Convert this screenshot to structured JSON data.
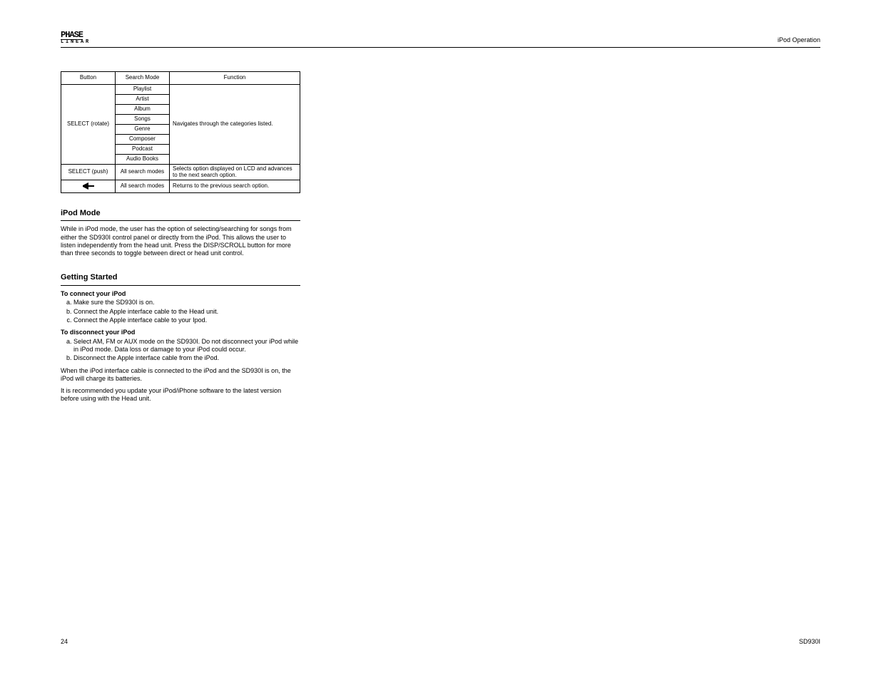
{
  "logo": {
    "main": "PHASE",
    "sub": "LINEAR"
  },
  "headerRight": "iPod Operation",
  "table": {
    "headers": {
      "button": "Button",
      "mode": "Search Mode",
      "function": "Function"
    },
    "row_select": {
      "button": "SELECT (rotate)",
      "modes": [
        "Playlist",
        "Artist",
        "Album",
        "Songs",
        "Genre",
        "Composer",
        "Podcast",
        "Audio Books"
      ],
      "function": "Navigates through the categories listed."
    },
    "row_select_push": {
      "button": "SELECT (push)",
      "mode": "All search modes",
      "function": "Selects option displayed on LCD and advances to the next search option."
    },
    "row_seek": {
      "button_icon": "seek-icon",
      "mode": "All search modes",
      "function": "Returns to the previous search option."
    }
  },
  "ipodMode": {
    "title": "iPod Mode",
    "body": "While in iPod mode, the user has the option of selecting/searching for songs from either the SD930I control panel or directly from the iPod. This allows the user to listen independently from the head unit. Press the DISP/SCROLL button for more than three seconds to toggle between direct or head unit control."
  },
  "getStarted": {
    "title": "Getting Started",
    "connect": {
      "head": "To connect your iPod",
      "steps": [
        "Make sure the SD930I is on.",
        "Connect the Apple interface cable to the Head unit.",
        "Connect the Apple interface cable to your Ipod."
      ]
    },
    "disconnect": {
      "head": "To disconnect your iPod",
      "steps": [
        "Select AM, FM or AUX mode on the SD930I. Do not disconnect your iPod while in iPod mode. Data loss or damage to your iPod could occur.",
        "Disconnect the Apple interface cable from the iPod."
      ]
    },
    "chargingNote": "When the iPod interface cable is connected to the iPod and the SD930I is on, the iPod will charge its batteries.",
    "versionNote": "It is recommended you update your iPod/iPhone software to the latest version before using with the Head unit."
  },
  "pageNumber": "24",
  "modelNumber": "SD930I"
}
